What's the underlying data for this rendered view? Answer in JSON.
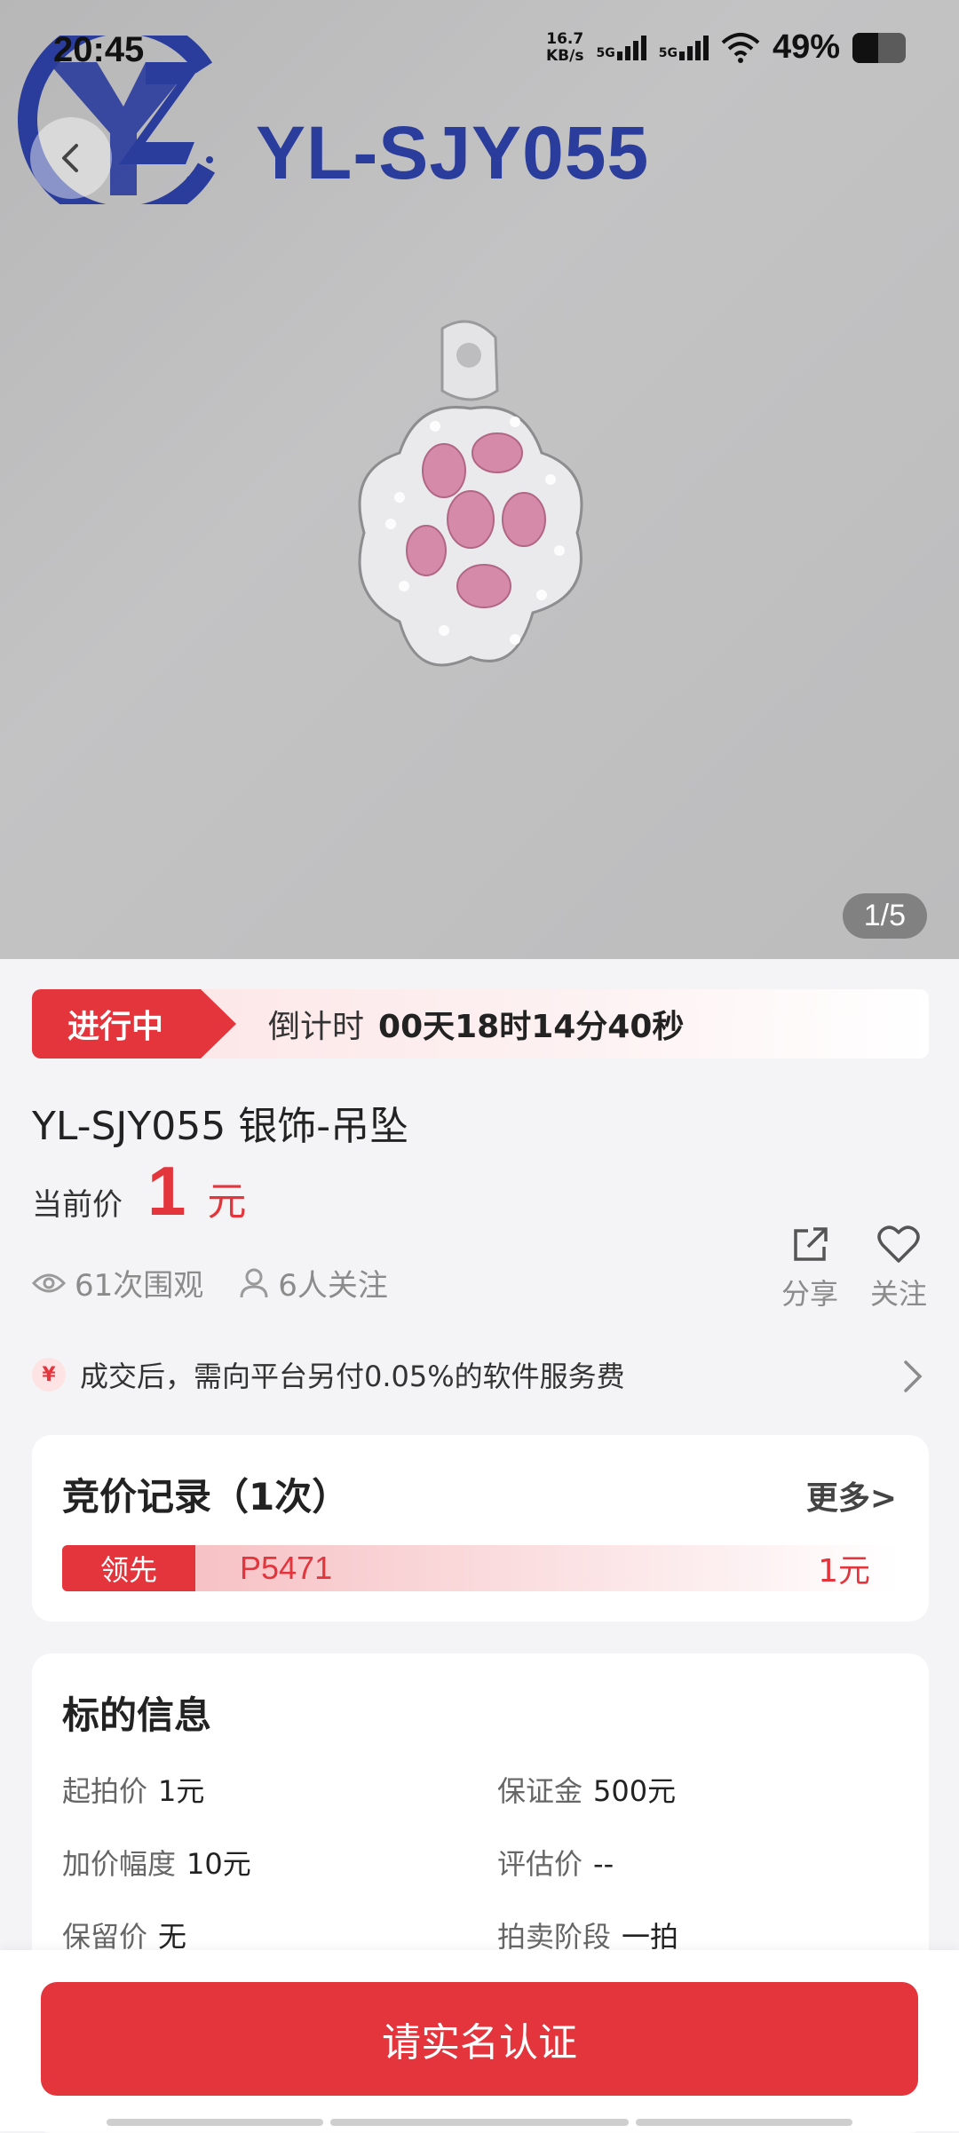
{
  "status_bar": {
    "time": "20:45",
    "speed_value": "16.7",
    "speed_unit": "KB/s",
    "net1": "5G",
    "net2": "5G",
    "battery": "49%",
    "battery_level": 0.49
  },
  "hero": {
    "logo_text": "YL-SJY055",
    "pager": "1/5"
  },
  "auction": {
    "status": "进行中",
    "countdown_label": "倒计时",
    "countdown_value": "00天18时14分40秒"
  },
  "product": {
    "title": "YL-SJY055 银饰-吊坠",
    "price_label": "当前价",
    "price_value": "1",
    "price_unit": "元",
    "views": "61次围观",
    "follows": "6人关注",
    "share_label": "分享",
    "follow_label": "关注"
  },
  "fee": {
    "icon": "¥",
    "text": "成交后，需向平台另付0.05%的软件服务费"
  },
  "bid_record": {
    "title": "竞价记录（1次）",
    "more": "更多>",
    "entries": [
      {
        "tag": "领先",
        "bidder": "P5471",
        "amount": "1元"
      }
    ]
  },
  "lot_info": {
    "title": "标的信息",
    "items": [
      {
        "label": "起拍价",
        "value": "1元"
      },
      {
        "label": "保证金",
        "value": "500元"
      },
      {
        "label": "加价幅度",
        "value": "10元"
      },
      {
        "label": "评估价",
        "value": "--"
      },
      {
        "label": "保留价",
        "value": "无"
      },
      {
        "label": "拍卖阶段",
        "value": "一拍"
      }
    ]
  },
  "cta": {
    "label": "请实名认证"
  },
  "colors": {
    "accent": "#e4343c",
    "logo_blue": "#2a3c9c"
  }
}
